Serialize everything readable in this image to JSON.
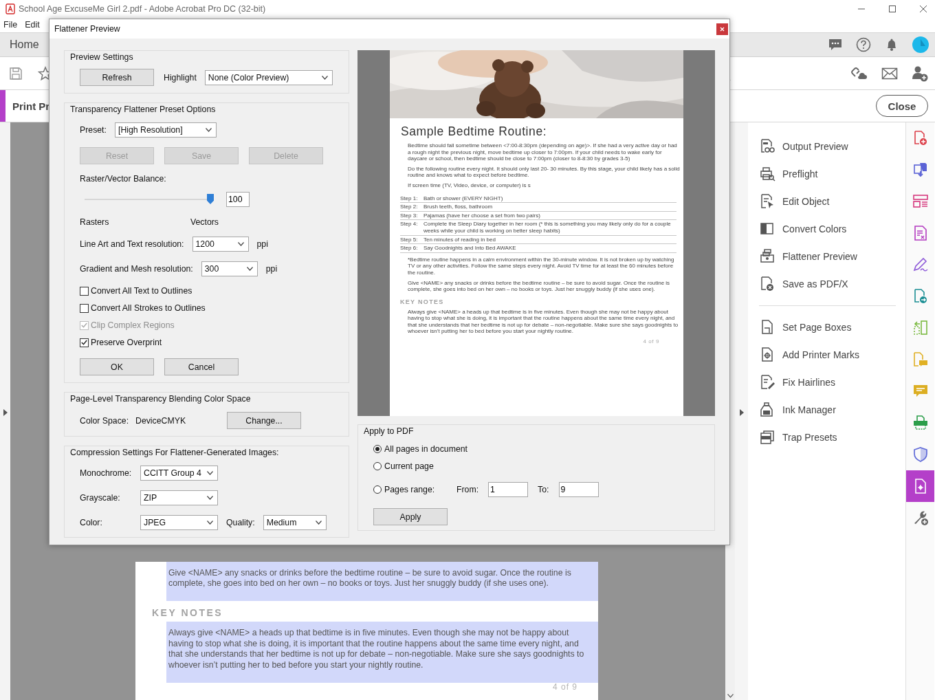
{
  "app_window": {
    "title": "School Age ExcuseMe Girl 2.pdf - Adobe Acrobat Pro DC (32-bit)"
  },
  "menu_bar": [
    "File",
    "Edit"
  ],
  "tabs": [
    {
      "label": "Home",
      "selected": true
    }
  ],
  "tool_header": {
    "title": "Print Pr",
    "close_button": "Close"
  },
  "document": {
    "blocks": [
      {
        "kind": "highlight",
        "text": "Give <NAME> any snacks or drinks before the bedtime routine – be sure to avoid sugar. Once the routine is complete, she goes into bed on her own – no books or toys. Just her snuggly buddy (if she uses one)."
      },
      {
        "kind": "heading",
        "text": "KEY NOTES"
      },
      {
        "kind": "highlight",
        "text": "Always give <NAME> a heads up that bedtime is in five minutes. Even though she may not be happy about having to stop what she is doing, it is important that the routine happens about the same time every night, and that she understands that her bedtime is not up for debate – non-negotiable. Make sure she says goodnights to whoever isn’t putting her to bed before you start your nightly routine."
      },
      {
        "kind": "folio",
        "text": "4 of 9"
      }
    ]
  },
  "tools_panel": {
    "groups": [
      {
        "items": [
          "Output Preview",
          "Preflight",
          "Edit Object",
          "Convert Colors",
          "Flattener Preview",
          "Save as PDF/X"
        ]
      },
      {
        "items": [
          "Set Page Boxes",
          "Add Printer Marks",
          "Fix Hairlines",
          "Ink Manager",
          "Trap Presets"
        ]
      }
    ]
  },
  "tool_rail": [
    {
      "selected": false
    },
    {
      "selected": false
    },
    {
      "selected": false
    },
    {
      "selected": false
    },
    {
      "selected": false
    },
    {
      "selected": false
    },
    {
      "selected": false
    },
    {
      "selected": false
    },
    {
      "selected": false
    },
    {
      "selected": false
    },
    {
      "selected": false
    },
    {
      "selected": true
    },
    {
      "selected": false
    }
  ],
  "dialog": {
    "title": "Flattener Preview",
    "preview_settings": {
      "title": "Preview Settings",
      "refresh_button": "Refresh",
      "highlight_label": "Highlight",
      "highlight_value": "None (Color Preview)"
    },
    "preset_options": {
      "title": "Transparency Flattener Preset Options",
      "preset_label": "Preset:",
      "preset_value": "[High Resolution]",
      "buttons": [
        {
          "label": "Reset",
          "disabled": true
        },
        {
          "label": "Save",
          "disabled": true
        },
        {
          "label": "Delete",
          "disabled": true
        }
      ],
      "balance_label": "Raster/Vector Balance:",
      "balance": {
        "level": 1,
        "value": "100"
      },
      "rasters_label": "Rasters",
      "vectors_label": "Vectors",
      "resolutions": [
        {
          "label": "Line Art and Text resolution:",
          "value": "1200",
          "unit": "ppi"
        },
        {
          "label": "Gradient and Mesh resolution:",
          "value": "300",
          "unit": "ppi"
        }
      ],
      "options": [
        {
          "label": "Convert All Text to Outlines",
          "checked": false,
          "disabled": false
        },
        {
          "label": "Convert All Strokes to Outlines",
          "checked": false,
          "disabled": false
        },
        {
          "label": "Clip Complex Regions",
          "checked": true,
          "disabled": true
        },
        {
          "label": "Preserve Overprint",
          "checked": true,
          "disabled": false
        }
      ],
      "ok_button": "OK",
      "cancel_button": "Cancel"
    },
    "color_space": {
      "title": "Page-Level Transparency Blending Color Space",
      "label": "Color Space:",
      "value": "DeviceCMYK",
      "change_button": "Change..."
    },
    "compression": {
      "title": "Compression Settings For Flattener-Generated Images:",
      "rows": [
        {
          "label": "Monochrome:",
          "value": "CCITT Group 4"
        },
        {
          "label": "Grayscale:",
          "value": "ZIP"
        },
        {
          "label": "Color:",
          "value": "JPEG",
          "quality_label": "Quality:",
          "quality_value": "Medium"
        }
      ]
    },
    "preview": {
      "title": "Sample Bedtime Routine:",
      "intro": [
        "Bedtime should fall sometime between <7:00-8:30pm (depending on age)>.  If she had a very active day or had a rough night the previous night, move bedtime up closer to 7:00pm. If your child needs to wake early for daycare or school, then bedtime should be close to 7:00pm (closer to 8-8:30 by grades 3-5)",
        "Do the following routine every night. It should only last 20- 30 minutes.  By this stage, your child likely has a solid routine and knows what to expect before bedtime.",
        "If screen time (TV, Video, device, or computer) is s"
      ],
      "steps": [
        {
          "label": "Step 1:",
          "text": "Bath or shower (EVERY NIGHT)"
        },
        {
          "label": "Step 2:",
          "text": "Brush teeth, floss, bathroom"
        },
        {
          "label": "Step 3:",
          "text": "Pajamas (have her choose a set from two pairs)"
        },
        {
          "label": "Step 4:",
          "text": "Complete the Sleep Diary together in her room (* this is something you may likely only do for a couple weeks while your child is working on better sleep habits)"
        },
        {
          "label": "Step 5:",
          "text": "Ten minutes of reading in bed"
        },
        {
          "label": "Step 6:",
          "text": "Say Goodnights and Into Bed AWAKE"
        }
      ],
      "notes": [
        "*Bedtime routine happens in a calm environment within the 30-minute window. It is not broken up by watching TV or any other activities. Follow the same steps every night. Avoid TV time for at least the 60 minutes before the routine.",
        "Give <NAME> any snacks or drinks before the bedtime routine – be sure to avoid sugar. Once the routine is complete, she goes into bed on her own – no books or toys. Just her snuggly buddy (if she uses one)."
      ],
      "heading": "KEY NOTES",
      "key_note": "Always give <NAME> a heads up that bedtime is in five minutes. Even though she may not be happy about having to stop what she is doing, it is important that the routine happens about the same time every night, and that she understands that her bedtime is not up for debate – non-negotiable. Make sure she says goodnights to whoever isn’t putting her to bed before you start your nightly routine.",
      "folio": "4 of 9"
    },
    "apply": {
      "title": "Apply to PDF",
      "scopes": [
        {
          "label": "All pages in document",
          "selected": true
        },
        {
          "label": "Current page",
          "selected": false
        },
        {
          "label": "Pages range:",
          "selected": false
        }
      ],
      "from_label": "From:",
      "from_value": "1",
      "to_label": "To:",
      "to_value": "9",
      "apply_button": "Apply"
    }
  }
}
